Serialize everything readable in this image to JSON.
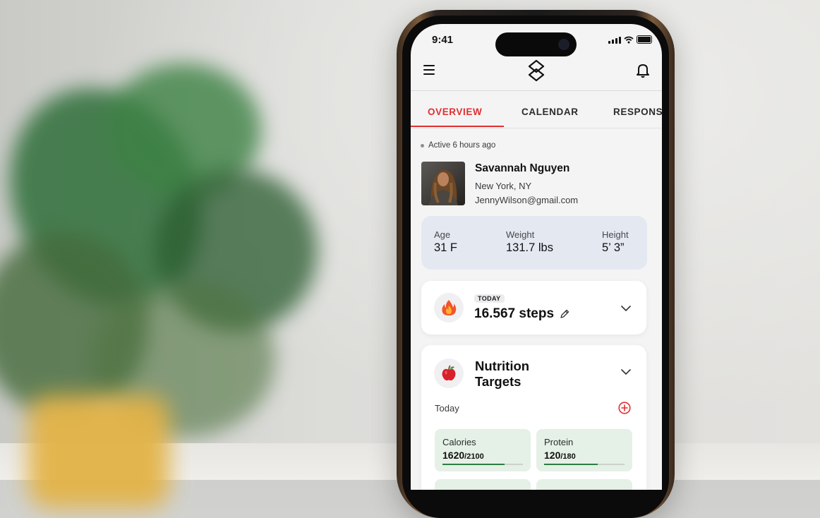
{
  "status_bar": {
    "time": "9:41"
  },
  "tabs": [
    {
      "label": "OVERVIEW"
    },
    {
      "label": "CALENDAR"
    },
    {
      "label": "RESPONS"
    }
  ],
  "profile": {
    "active_text": "Active 6 hours ago",
    "name": "Savannah Nguyen",
    "location": "New York, NY",
    "email": "JennyWilson@gmail.com"
  },
  "stats": {
    "age": {
      "label": "Age",
      "value": "31 F"
    },
    "weight": {
      "label": "Weight",
      "value": "131.7 lbs"
    },
    "height": {
      "label": "Height",
      "value": "5’ 3”"
    }
  },
  "steps": {
    "badge": "TODAY",
    "value": "16.567 steps",
    "icon": "fire-icon"
  },
  "nutrition": {
    "title": "Nutrition Targets",
    "icon": "apple-icon",
    "today_label": "Today",
    "macros": [
      {
        "label": "Calories",
        "current": "1620",
        "target": "/2100",
        "progress": 0.77
      },
      {
        "label": "Protein",
        "current": "120",
        "target": "/180",
        "progress": 0.67
      }
    ]
  },
  "colors": {
    "accent": "#e0302f",
    "stats_bg": "#e4e8f1",
    "macro_bg": "#e5f0e6",
    "progress": "#2e7d43"
  }
}
